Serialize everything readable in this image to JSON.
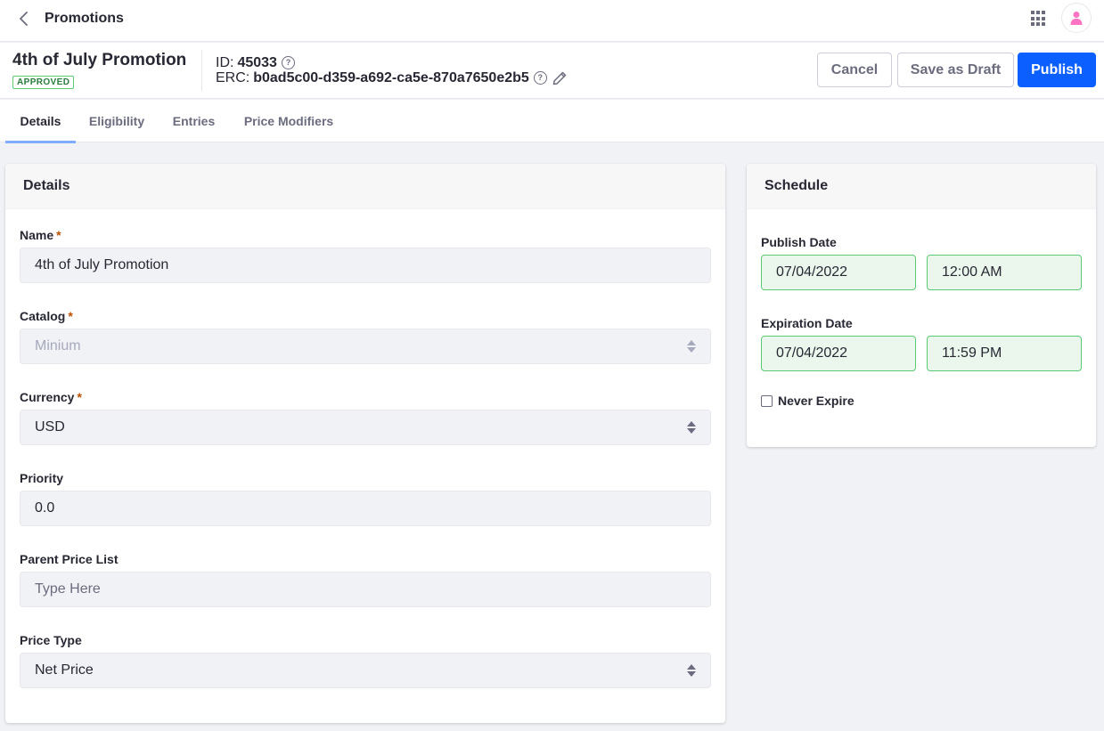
{
  "topbar": {
    "title": "Promotions",
    "back_icon": "chevron-left-icon",
    "apps_icon": "apps-grid-icon",
    "avatar_icon": "user-icon",
    "avatar_color": "#ff73c3"
  },
  "header": {
    "promotion_title": "4th of July Promotion",
    "status_badge": "APPROVED",
    "id_label": "ID:",
    "id_value": "45033",
    "erc_label": "ERC:",
    "erc_value": "b0ad5c00-d359-a692-ca5e-870a7650e2b5",
    "help_icon_glyph": "?",
    "actions": {
      "cancel": "Cancel",
      "save_draft": "Save as Draft",
      "publish": "Publish"
    }
  },
  "tabs": [
    {
      "label": "Details",
      "active": true
    },
    {
      "label": "Eligibility",
      "active": false
    },
    {
      "label": "Entries",
      "active": false
    },
    {
      "label": "Price Modifiers",
      "active": false
    }
  ],
  "details": {
    "title": "Details",
    "required_mark": "*",
    "fields": {
      "name": {
        "label": "Name",
        "value": "4th of July Promotion",
        "required": true
      },
      "catalog": {
        "label": "Catalog",
        "value": "Minium",
        "required": true,
        "disabled": true
      },
      "currency": {
        "label": "Currency",
        "value": "USD",
        "required": true
      },
      "priority": {
        "label": "Priority",
        "value": "0.0"
      },
      "parent_price_list": {
        "label": "Parent Price List",
        "placeholder": "Type Here",
        "value": ""
      },
      "price_type": {
        "label": "Price Type",
        "value": "Net Price"
      }
    }
  },
  "schedule": {
    "title": "Schedule",
    "publish_date": {
      "label": "Publish Date",
      "date": "07/04/2022",
      "time": "12:00 AM"
    },
    "expiration_date": {
      "label": "Expiration Date",
      "date": "07/04/2022",
      "time": "11:59 PM"
    },
    "never_expire": {
      "label": "Never Expire",
      "checked": false
    }
  },
  "colors": {
    "primary": "#0b5fff",
    "success_border": "#5aca75",
    "success_bg": "#ebf7ed",
    "badge_text": "#287d3c",
    "required": "#b95000",
    "tab_indicator": "#80acff"
  }
}
